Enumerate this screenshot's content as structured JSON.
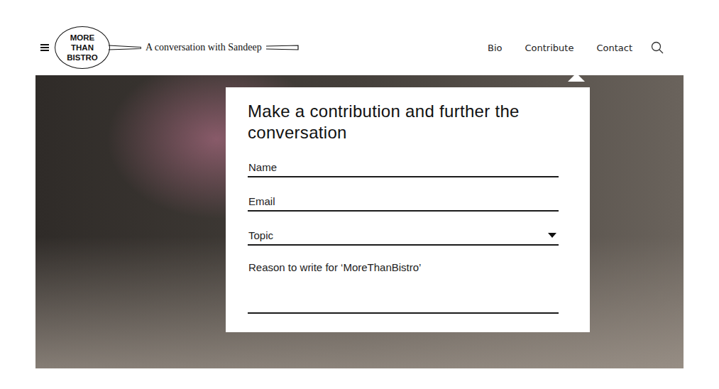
{
  "header": {
    "logo": [
      "MORE",
      "THAN",
      "BISTRO"
    ],
    "tagline": "A conversation with Sandeep"
  },
  "nav": [
    {
      "label": "Bio",
      "selected": false
    },
    {
      "label": "Contribute",
      "selected": true
    },
    {
      "label": "Contact",
      "selected": false
    }
  ],
  "form": {
    "title": "Make a contribution and further the conversation",
    "fields": [
      {
        "label": "Name",
        "kind": "text"
      },
      {
        "label": "Email",
        "kind": "text"
      },
      {
        "label": "Topic",
        "kind": "select"
      },
      {
        "label": "Reason to write for ‘MoreThanBistro’",
        "kind": "textarea"
      }
    ]
  }
}
